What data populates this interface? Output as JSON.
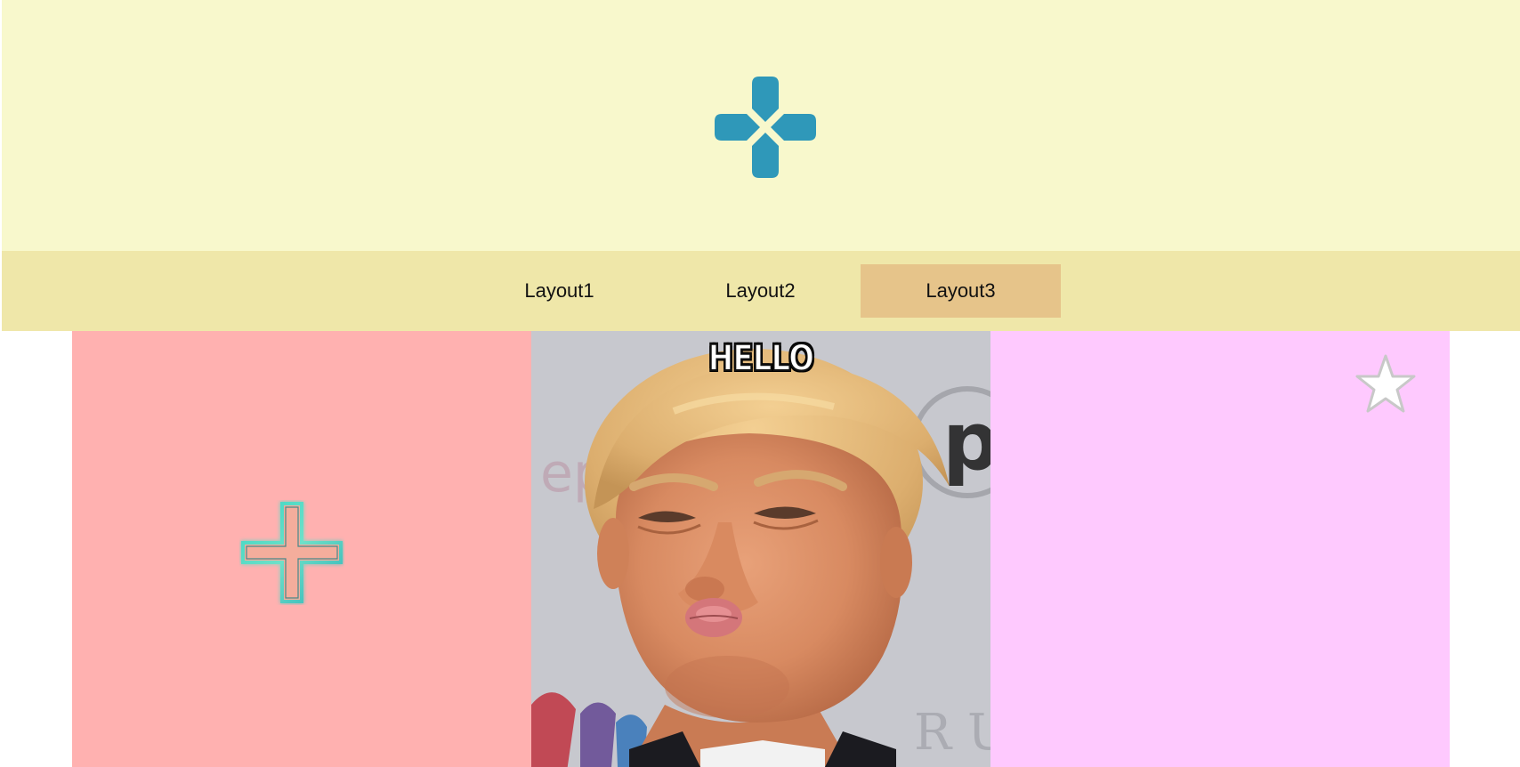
{
  "header": {
    "logo_icon": "gamepad-dpad-icon",
    "logo_color": "#2f98b9"
  },
  "nav": {
    "items": [
      {
        "label": "Layout1",
        "active": false
      },
      {
        "label": "Layout2",
        "active": false
      },
      {
        "label": "Layout3",
        "active": true
      }
    ]
  },
  "panels": {
    "left": {
      "icon": "glowing-plus-icon",
      "color": "#ffb1b0"
    },
    "middle": {
      "image": "meme-photo",
      "caption": "HELLO"
    },
    "right": {
      "icon": "star-icon",
      "color": "#fec9fe"
    }
  }
}
